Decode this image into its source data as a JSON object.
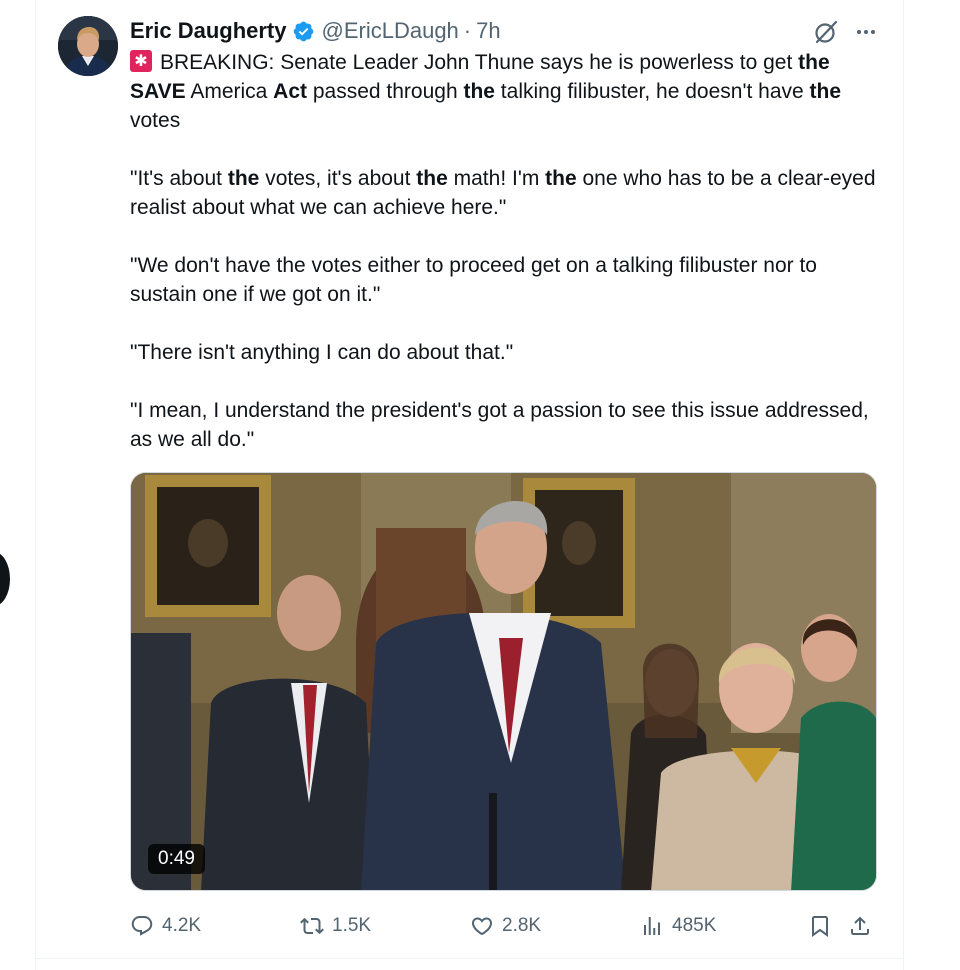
{
  "author": {
    "name": "Eric Daugherty",
    "handle": "@EricLDaugh",
    "separator": "·",
    "time": "7h",
    "verified": true
  },
  "tweet": {
    "paragraphs": [
      [
        {
          "t": "BREAKING: Senate Leader John Thune says he is powerless to get ",
          "b": false
        },
        {
          "t": "the",
          "b": true
        },
        {
          "t": " ",
          "b": false
        },
        {
          "t": "SAVE",
          "b": true
        },
        {
          "t": " America ",
          "b": false
        },
        {
          "t": "Act",
          "b": true
        },
        {
          "t": " passed through ",
          "b": false
        },
        {
          "t": "the",
          "b": true
        },
        {
          "t": " talking filibuster, he doesn't have ",
          "b": false
        },
        {
          "t": "the",
          "b": true
        },
        {
          "t": " votes",
          "b": false
        }
      ],
      [
        {
          "t": "\"It's about ",
          "b": false
        },
        {
          "t": "the",
          "b": true
        },
        {
          "t": " votes, it's about ",
          "b": false
        },
        {
          "t": "the",
          "b": true
        },
        {
          "t": " math! I'm ",
          "b": false
        },
        {
          "t": "the",
          "b": true
        },
        {
          "t": " one who has to be a clear-eyed realist about what we can achieve here.\"",
          "b": false
        }
      ],
      [
        {
          "t": "\"We don't have the votes either to proceed get on a talking filibuster nor to sustain one if we got on it.\"",
          "b": false
        }
      ],
      [
        {
          "t": "\"There isn't anything I can do about that.\"",
          "b": false
        }
      ],
      [
        {
          "t": "\"I mean, I understand the president's got a passion to see this issue addressed, as we all do.\"",
          "b": false
        }
      ]
    ],
    "lead_emoji": "rotating-light-emoji"
  },
  "media": {
    "type": "video",
    "duration": "0:49"
  },
  "metrics": {
    "replies": "4.2K",
    "reposts": "1.5K",
    "likes": "2.8K",
    "views": "485K"
  },
  "icons": {
    "reply": "reply-icon",
    "repost": "repost-icon",
    "like": "like-icon",
    "views": "views-icon",
    "bookmark": "bookmark-icon",
    "share": "share-icon",
    "grok": "grok-icon",
    "more": "more-icon"
  },
  "colors": {
    "text": "#0f1419",
    "muted": "#536471",
    "verified": "#1d9bf0",
    "border": "#eff3f4",
    "siren": "#e0245e"
  }
}
